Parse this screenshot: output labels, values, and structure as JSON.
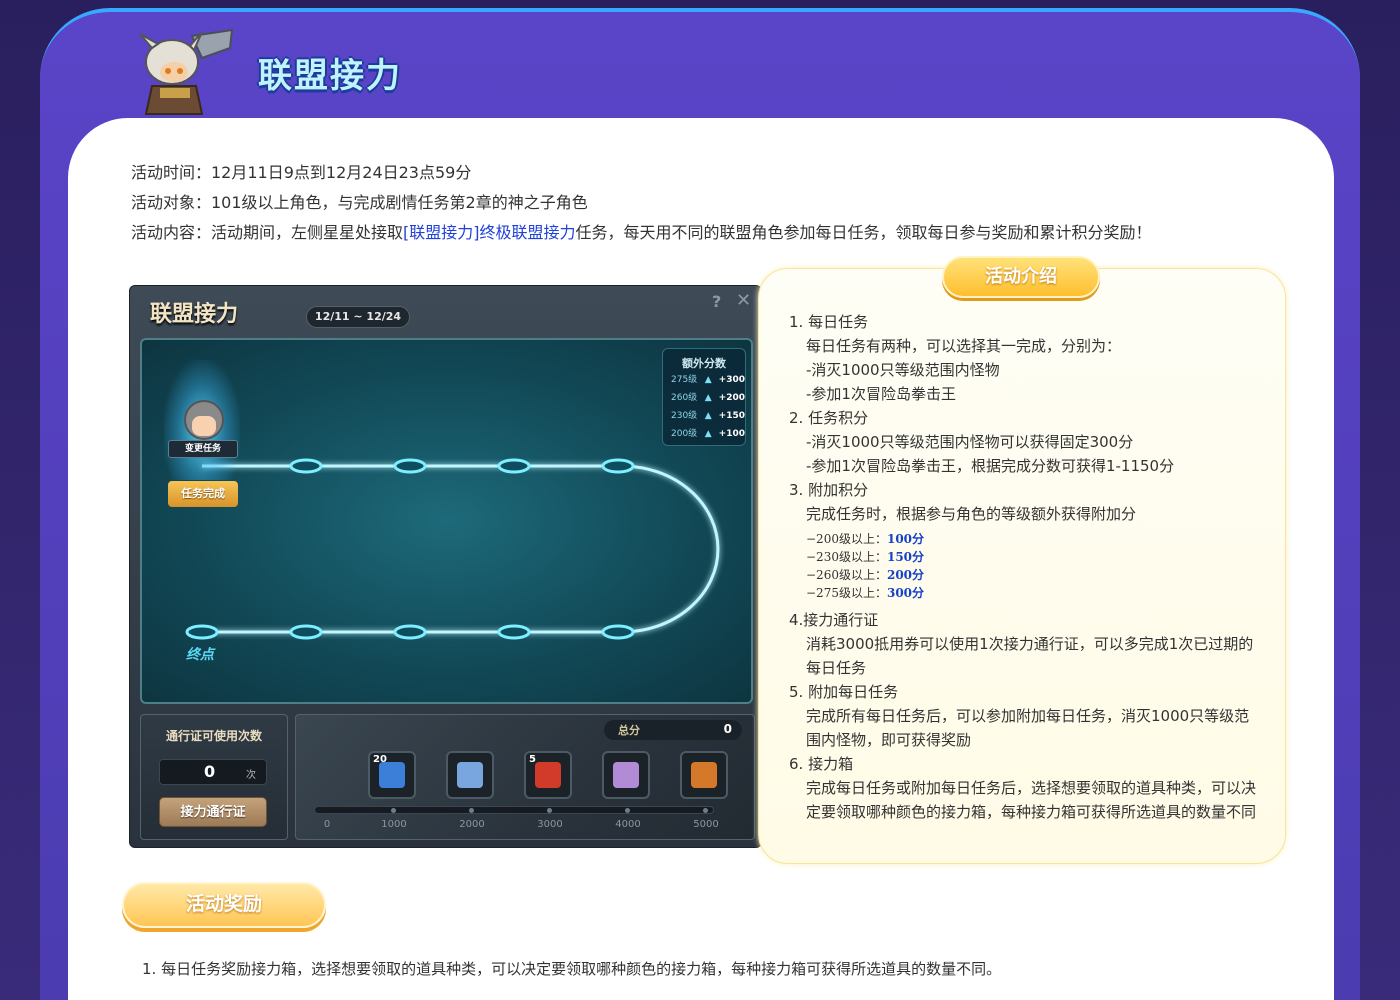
{
  "header": {
    "title": "联盟接力"
  },
  "info": {
    "time": "活动时间：12月11日9点到12月24日23点59分",
    "target": "活动对象：101级以上角色，与完成剧情任务第2章的神之子角色",
    "content_prefix": "活动内容：活动期间，左侧星星处接取",
    "content_link": "[联盟接力]终极联盟接力",
    "content_suffix": "任务，每天用不同的联盟角色参加每日任务，领取每日参与奖励和累计积分奖励！"
  },
  "panel": {
    "title": "联盟接力",
    "date_range": "12/11 ~ 12/24",
    "help": "?",
    "close": "✕",
    "bonus": {
      "title": "额外分数",
      "rows": [
        {
          "level": "275级",
          "points": "+300"
        },
        {
          "level": "260级",
          "points": "+200"
        },
        {
          "level": "230级",
          "points": "+150"
        },
        {
          "level": "200级",
          "points": "+100"
        }
      ]
    },
    "change_task": "变更任务",
    "task_done": "任务完成",
    "end_label": "终点",
    "pass": {
      "label": "通行证可使用次数",
      "count": "0",
      "unit": "次",
      "button": "接力通行证"
    },
    "total": {
      "label": "总分",
      "value": "0"
    },
    "slots": [
      {
        "badge": "20",
        "icon": "vip-ticket-icon",
        "color": "#3b7fd9"
      },
      {
        "badge": "",
        "icon": "mystery-card-icon",
        "color": "#7aa6e0"
      },
      {
        "badge": "5",
        "icon": "red-gem-icon",
        "color": "#d23a2a"
      },
      {
        "badge": "",
        "icon": "calendar-scroll-icon",
        "color": "#b28bd6"
      },
      {
        "badge": "",
        "icon": "merchant-icon",
        "color": "#d5782a"
      }
    ],
    "progress": 0,
    "ticks": [
      "0",
      "1000",
      "2000",
      "3000",
      "4000",
      "5000"
    ]
  },
  "intro": {
    "tab": "活动介绍",
    "lines": [
      "1. 每日任务",
      "每日任务有两种，可以选择其一完成，分别为：",
      "-消灭1000只等级范围内怪物",
      "-参加1次冒险岛拳击王",
      "2. 任务积分",
      "-消灭1000只等级范围内怪物可以获得固定300分",
      "-参加1次冒险岛拳击王，根据完成分数可获得1-1150分",
      "3. 附加积分",
      "完成任务时，根据参与角色的等级额外获得附加分"
    ],
    "bonus_levels": [
      {
        "label": "−200级以上：",
        "pts": "100分"
      },
      {
        "label": "−230级以上：",
        "pts": "150分"
      },
      {
        "label": "−260级以上：",
        "pts": "200分"
      },
      {
        "label": "−275级以上：",
        "pts": "300分"
      }
    ],
    "lines2": [
      "4.接力通行证",
      "消耗3000抵用券可以使用1次接力通行证，可以多完成1次已过期的",
      "每日任务",
      "5. 附加每日任务",
      "完成所有每日任务后，可以参加附加每日任务，消灭1000只等级范",
      "围内怪物，即可获得奖励",
      "6. 接力箱",
      "完成每日任务或附加每日任务后，选择想要领取的道具种类，可以决",
      "定要领取哪种颜色的接力箱，每种接力箱可获得所选道具的数量不同"
    ]
  },
  "rewards": {
    "tab": "活动奖励",
    "line1": "1. 每日任务奖励接力箱，选择想要领取的道具种类，可以决定要领取哪种颜色的接力箱，每种接力箱可获得所选道具的数量不同。"
  }
}
